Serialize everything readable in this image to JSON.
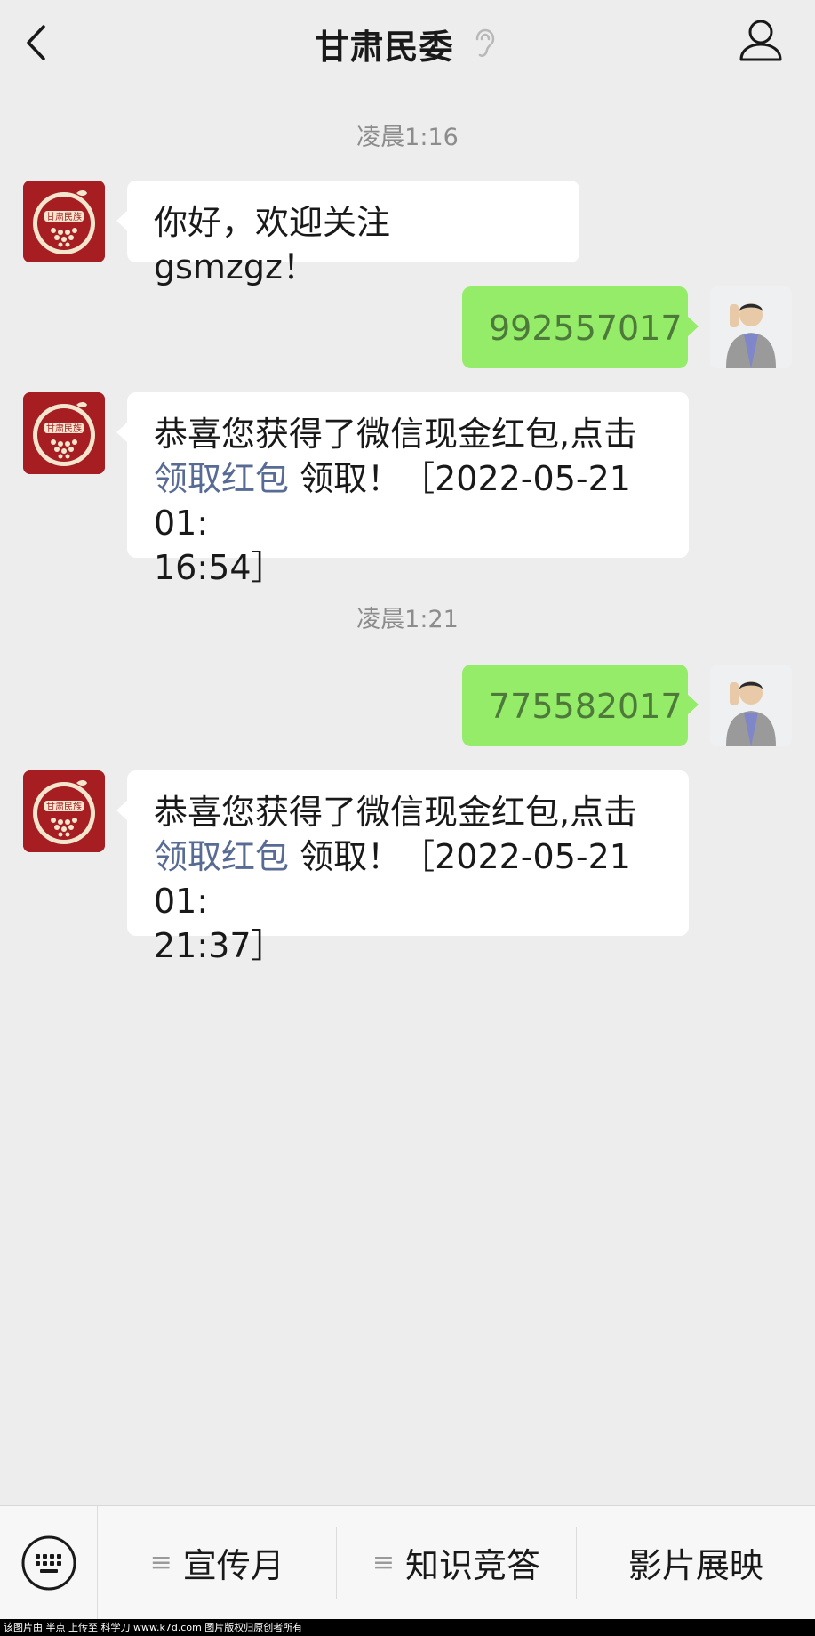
{
  "header": {
    "title": "甘肃民委"
  },
  "messages": {
    "time1": "凌晨1:16",
    "m1": "你好，欢迎关注 gsmzgz！",
    "m2": "992557017",
    "m3_text": "恭喜您获得了微信现金红包,点击",
    "m3_link": "领取红包",
    "m3_rest": " 领取！［2022-05-21 01:",
    "m3_end": "16:54］",
    "time2": "凌晨1:21",
    "m4": "775582017",
    "m5_text": "恭喜您获得了微信现金红包,点击",
    "m5_link": "领取红包",
    "m5_rest": " 领取！［2022-05-21 01:",
    "m5_end": "21:37］"
  },
  "avatar_official": {
    "logo_text": "甘肃民族"
  },
  "menu": {
    "items": [
      {
        "label": "宣传月",
        "has_submenu": true
      },
      {
        "label": "知识竞答",
        "has_submenu": true
      },
      {
        "label": "影片展映",
        "has_submenu": false
      }
    ]
  },
  "footer": {
    "text": "该图片由 半点 上传至 科学刀 www.k7d.com 图片版权归原创者所有"
  },
  "colors": {
    "background": "#ededed",
    "sent_bubble": "#95ec69",
    "link": "#576b95",
    "official_avatar": "#a61e22"
  }
}
